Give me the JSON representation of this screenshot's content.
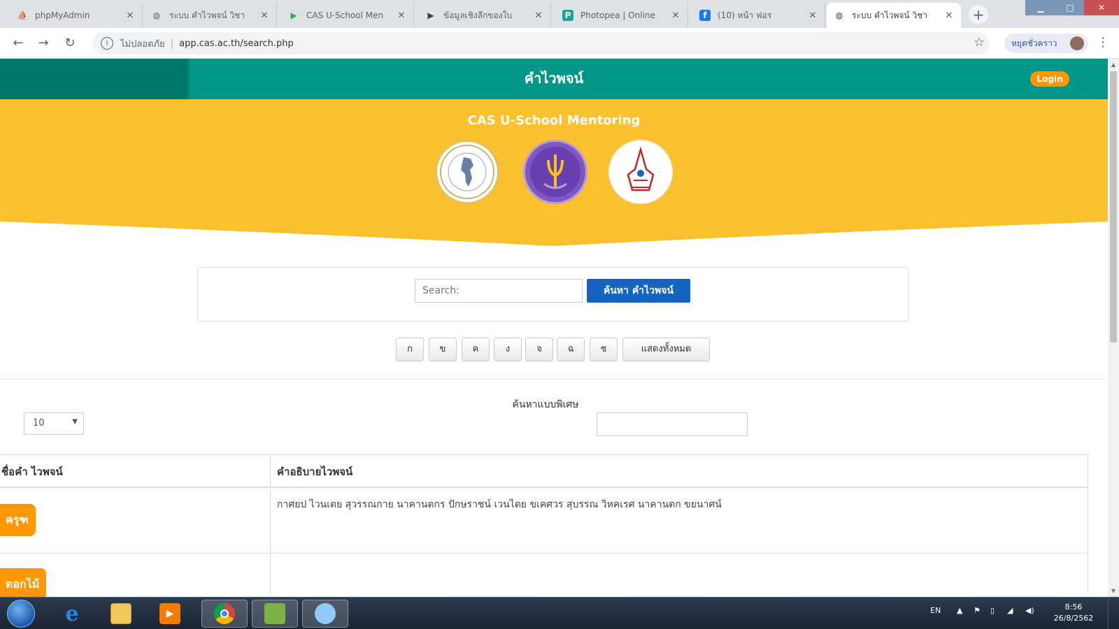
{
  "browser": {
    "tabs": [
      {
        "label": "phpMyAdmin",
        "icon": "phpmyadmin-icon",
        "color": "#f29111",
        "glyph": "⛵"
      },
      {
        "label": "ระบบ คำไวพจน์ วิชา",
        "icon": "globe-icon",
        "color": "#5f6368",
        "glyph": "◍"
      },
      {
        "label": "CAS U-School Men",
        "icon": "play-store-icon",
        "color": "#34a853",
        "glyph": "▶"
      },
      {
        "label": "ข้อมูลเชิงลึกของใบ",
        "icon": "play-console-icon",
        "color": "#3c4043",
        "glyph": "▶"
      },
      {
        "label": "Photopea | Online",
        "icon": "photopea-icon",
        "color": "#18a497",
        "glyph": "P"
      },
      {
        "label": "(10) หน้า ฟอร",
        "icon": "facebook-icon",
        "color": "#1877f2",
        "glyph": "f"
      },
      {
        "label": "ระบบ คำไวพจน์ วิชา",
        "icon": "globe-icon",
        "color": "#5f6368",
        "glyph": "◍"
      }
    ],
    "new_tab": "+",
    "address": {
      "secure_label": "ไม่ปลอดภัย",
      "url": "app.cas.ac.th/search.php"
    },
    "profile_label": "หยุดชั่วคราว"
  },
  "header": {
    "title": "คำไวพจน์",
    "login_label": "Login",
    "brand": "CAS U-School Mentoring",
    "colors": {
      "teal": "#009688",
      "teal_dark": "#00796b",
      "yellow": "#fbc02d",
      "orange": "#ff9800"
    }
  },
  "search": {
    "placeholder": "Search:",
    "button_label": "ค้นหา คำไวพจน์"
  },
  "alphabet": [
    "ก",
    "ข",
    "ค",
    "ง",
    "จ",
    "ฉ",
    "ช"
  ],
  "show_all_label": "แสดงทั้งหมด",
  "controls": {
    "page_size": "10",
    "advanced_search_label": "ค้นหาแบบพิเศษ"
  },
  "table": {
    "headers": [
      "ชื่อคำ ไวพจน์",
      "คำอธิบายไวพจน์"
    ],
    "rows": [
      {
        "word": "ครุฑ",
        "description": "กาศยป ไวนเตย สุวรรณกาย นาคานตกร ปักษราชน์ เวนไตย ขเคศวร สุบรรณ วิหคเรศ นาคานตก ขยนาศน์"
      },
      {
        "word": "ดอกไม้",
        "description": ""
      }
    ]
  },
  "taskbar": {
    "apps": [
      {
        "name": "ie-icon",
        "color": "#1e88e5"
      },
      {
        "name": "file-explorer-icon",
        "color": "#f1c75a"
      },
      {
        "name": "media-player-icon",
        "color": "#f57c00"
      },
      {
        "name": "chrome-icon",
        "color": "#db4437"
      },
      {
        "name": "notepad-icon",
        "color": "#7cb342"
      },
      {
        "name": "app-icon",
        "color": "#90caf9"
      }
    ],
    "lang": "EN",
    "time": "8:56",
    "date": "26/8/2562"
  }
}
